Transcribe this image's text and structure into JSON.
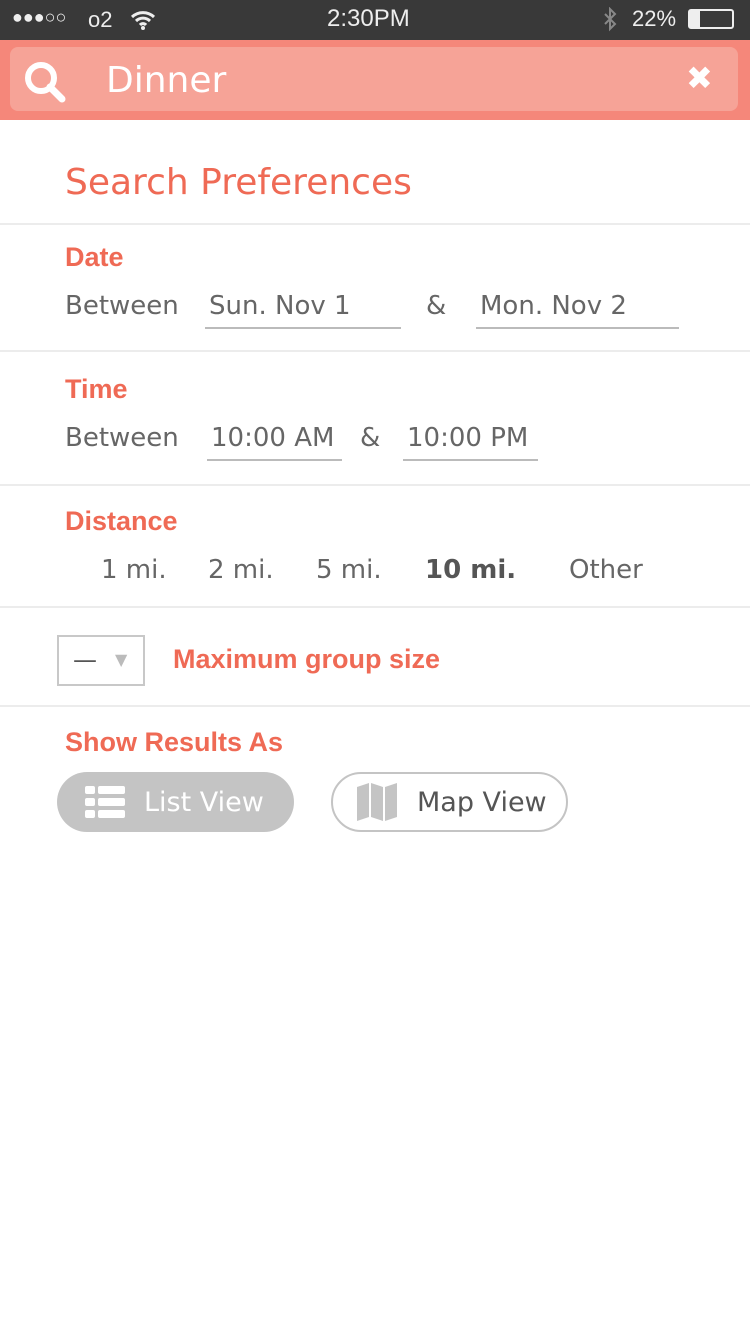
{
  "status_bar": {
    "carrier": "o2",
    "signal": "●●●○○",
    "time": "2:30PM",
    "battery": "22%"
  },
  "search": {
    "value": "Dinner",
    "clear_icon": "close-icon"
  },
  "title": "Search Preferences",
  "date": {
    "label": "Date",
    "between": "Between",
    "start": "Sun. Nov 1",
    "and": "&",
    "end": "Mon. Nov 2"
  },
  "time": {
    "label": "Time",
    "between": "Between",
    "start": "10:00 AM",
    "and": "&",
    "end": "10:00 PM"
  },
  "distance": {
    "label": "Distance",
    "options": [
      "1 mi.",
      "2 mi.",
      "5 mi.",
      "10 mi.",
      "Other"
    ],
    "selected": "10 mi."
  },
  "group": {
    "value": "—",
    "label": "Maximum group size"
  },
  "results": {
    "label": "Show Results As",
    "list": "List View",
    "map": "Map View",
    "selected": "List View"
  },
  "colors": {
    "accent": "#ef6a55",
    "header": "#f5877a",
    "search_field": "#f6a397"
  }
}
